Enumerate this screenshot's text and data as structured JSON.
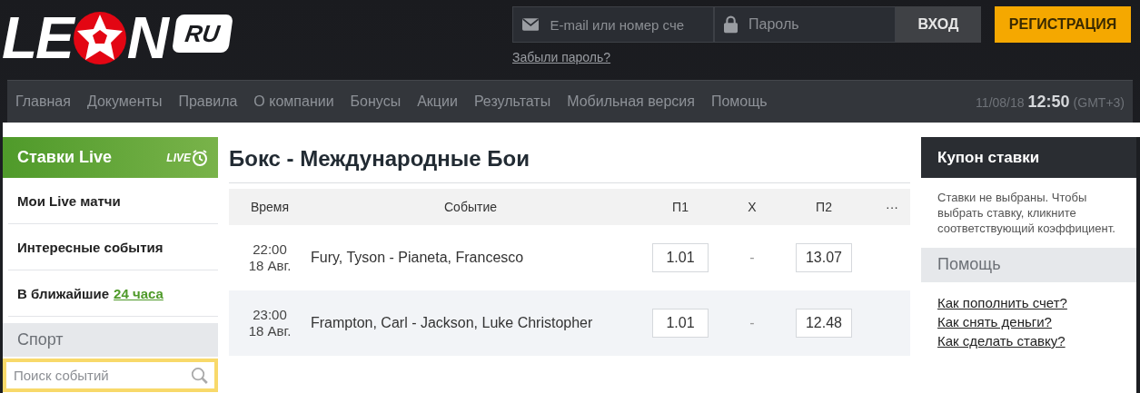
{
  "logo": {
    "left": "LE",
    "right": "N",
    "badge": "RU"
  },
  "login": {
    "email_placeholder": "E-mail или номер сче",
    "password_placeholder": "Пароль",
    "forgot": "Забыли пароль?",
    "login_button": "ВХОД",
    "register_button": "РЕГИСТРАЦИЯ"
  },
  "nav": [
    "Главная",
    "Документы",
    "Правила",
    "О компании",
    "Бонусы",
    "Акции",
    "Результаты",
    "Мобильная версия",
    "Помощь"
  ],
  "clock": {
    "date": "11/08/18",
    "time": "12:50",
    "zone": "(GMT+3)"
  },
  "sidebar": {
    "title": "Ставки Live",
    "badge": "LIVE",
    "items": [
      {
        "text": "Мои Live матчи"
      },
      {
        "text": "Интересные события"
      },
      {
        "text": "В ближайшие",
        "link": "24 часа"
      }
    ],
    "section": "Спорт",
    "search_placeholder": "Поиск событий"
  },
  "main": {
    "title": "Бокс - Международные Бои",
    "columns": [
      "Время",
      "Событие",
      "П1",
      "Х",
      "П2",
      "···"
    ],
    "rows": [
      {
        "time": "22:00",
        "date": "18 Авг.",
        "event": "Fury, Tyson - Pianeta, Francesco",
        "p1": "1.01",
        "x": "-",
        "p2": "13.07"
      },
      {
        "time": "23:00",
        "date": "18 Авг.",
        "event": "Frampton, Carl - Jackson, Luke Christopher",
        "p1": "1.01",
        "x": "-",
        "p2": "12.48"
      }
    ]
  },
  "coupon": {
    "title": "Купон ставки",
    "text": "Ставки не выбраны. Чтобы выбрать ставку, кликните соответствующий коэффициент.",
    "help_title": "Помощь",
    "help_links": [
      "Как пополнить счет?",
      "Как снять деньги?",
      "Как сделать ставку?"
    ]
  }
}
